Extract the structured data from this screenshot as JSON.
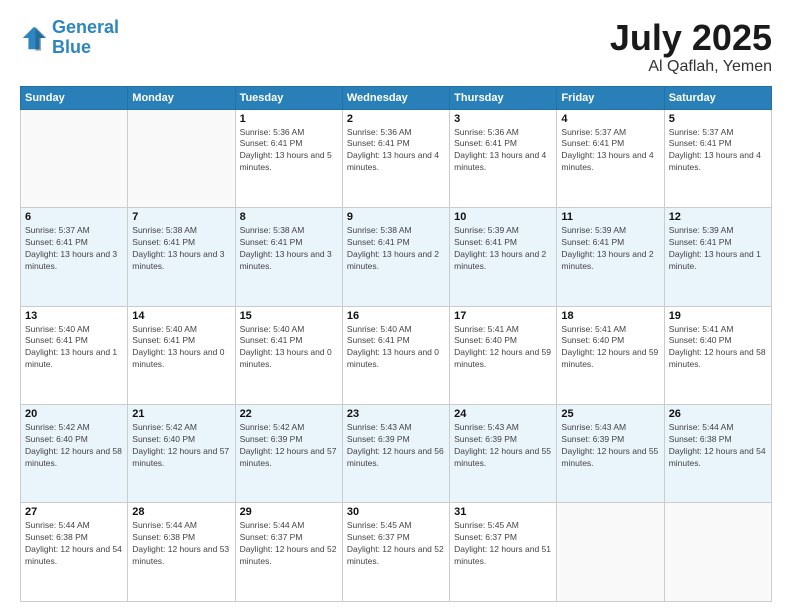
{
  "header": {
    "logo_line1": "General",
    "logo_line2": "Blue",
    "month": "July 2025",
    "location": "Al Qaflah, Yemen"
  },
  "weekdays": [
    "Sunday",
    "Monday",
    "Tuesday",
    "Wednesday",
    "Thursday",
    "Friday",
    "Saturday"
  ],
  "weeks": [
    [
      {
        "day": "",
        "info": ""
      },
      {
        "day": "",
        "info": ""
      },
      {
        "day": "1",
        "info": "Sunrise: 5:36 AM\nSunset: 6:41 PM\nDaylight: 13 hours and 5 minutes."
      },
      {
        "day": "2",
        "info": "Sunrise: 5:36 AM\nSunset: 6:41 PM\nDaylight: 13 hours and 4 minutes."
      },
      {
        "day": "3",
        "info": "Sunrise: 5:36 AM\nSunset: 6:41 PM\nDaylight: 13 hours and 4 minutes."
      },
      {
        "day": "4",
        "info": "Sunrise: 5:37 AM\nSunset: 6:41 PM\nDaylight: 13 hours and 4 minutes."
      },
      {
        "day": "5",
        "info": "Sunrise: 5:37 AM\nSunset: 6:41 PM\nDaylight: 13 hours and 4 minutes."
      }
    ],
    [
      {
        "day": "6",
        "info": "Sunrise: 5:37 AM\nSunset: 6:41 PM\nDaylight: 13 hours and 3 minutes."
      },
      {
        "day": "7",
        "info": "Sunrise: 5:38 AM\nSunset: 6:41 PM\nDaylight: 13 hours and 3 minutes."
      },
      {
        "day": "8",
        "info": "Sunrise: 5:38 AM\nSunset: 6:41 PM\nDaylight: 13 hours and 3 minutes."
      },
      {
        "day": "9",
        "info": "Sunrise: 5:38 AM\nSunset: 6:41 PM\nDaylight: 13 hours and 2 minutes."
      },
      {
        "day": "10",
        "info": "Sunrise: 5:39 AM\nSunset: 6:41 PM\nDaylight: 13 hours and 2 minutes."
      },
      {
        "day": "11",
        "info": "Sunrise: 5:39 AM\nSunset: 6:41 PM\nDaylight: 13 hours and 2 minutes."
      },
      {
        "day": "12",
        "info": "Sunrise: 5:39 AM\nSunset: 6:41 PM\nDaylight: 13 hours and 1 minute."
      }
    ],
    [
      {
        "day": "13",
        "info": "Sunrise: 5:40 AM\nSunset: 6:41 PM\nDaylight: 13 hours and 1 minute."
      },
      {
        "day": "14",
        "info": "Sunrise: 5:40 AM\nSunset: 6:41 PM\nDaylight: 13 hours and 0 minutes."
      },
      {
        "day": "15",
        "info": "Sunrise: 5:40 AM\nSunset: 6:41 PM\nDaylight: 13 hours and 0 minutes."
      },
      {
        "day": "16",
        "info": "Sunrise: 5:40 AM\nSunset: 6:41 PM\nDaylight: 13 hours and 0 minutes."
      },
      {
        "day": "17",
        "info": "Sunrise: 5:41 AM\nSunset: 6:40 PM\nDaylight: 12 hours and 59 minutes."
      },
      {
        "day": "18",
        "info": "Sunrise: 5:41 AM\nSunset: 6:40 PM\nDaylight: 12 hours and 59 minutes."
      },
      {
        "day": "19",
        "info": "Sunrise: 5:41 AM\nSunset: 6:40 PM\nDaylight: 12 hours and 58 minutes."
      }
    ],
    [
      {
        "day": "20",
        "info": "Sunrise: 5:42 AM\nSunset: 6:40 PM\nDaylight: 12 hours and 58 minutes."
      },
      {
        "day": "21",
        "info": "Sunrise: 5:42 AM\nSunset: 6:40 PM\nDaylight: 12 hours and 57 minutes."
      },
      {
        "day": "22",
        "info": "Sunrise: 5:42 AM\nSunset: 6:39 PM\nDaylight: 12 hours and 57 minutes."
      },
      {
        "day": "23",
        "info": "Sunrise: 5:43 AM\nSunset: 6:39 PM\nDaylight: 12 hours and 56 minutes."
      },
      {
        "day": "24",
        "info": "Sunrise: 5:43 AM\nSunset: 6:39 PM\nDaylight: 12 hours and 55 minutes."
      },
      {
        "day": "25",
        "info": "Sunrise: 5:43 AM\nSunset: 6:39 PM\nDaylight: 12 hours and 55 minutes."
      },
      {
        "day": "26",
        "info": "Sunrise: 5:44 AM\nSunset: 6:38 PM\nDaylight: 12 hours and 54 minutes."
      }
    ],
    [
      {
        "day": "27",
        "info": "Sunrise: 5:44 AM\nSunset: 6:38 PM\nDaylight: 12 hours and 54 minutes."
      },
      {
        "day": "28",
        "info": "Sunrise: 5:44 AM\nSunset: 6:38 PM\nDaylight: 12 hours and 53 minutes."
      },
      {
        "day": "29",
        "info": "Sunrise: 5:44 AM\nSunset: 6:37 PM\nDaylight: 12 hours and 52 minutes."
      },
      {
        "day": "30",
        "info": "Sunrise: 5:45 AM\nSunset: 6:37 PM\nDaylight: 12 hours and 52 minutes."
      },
      {
        "day": "31",
        "info": "Sunrise: 5:45 AM\nSunset: 6:37 PM\nDaylight: 12 hours and 51 minutes."
      },
      {
        "day": "",
        "info": ""
      },
      {
        "day": "",
        "info": ""
      }
    ]
  ]
}
